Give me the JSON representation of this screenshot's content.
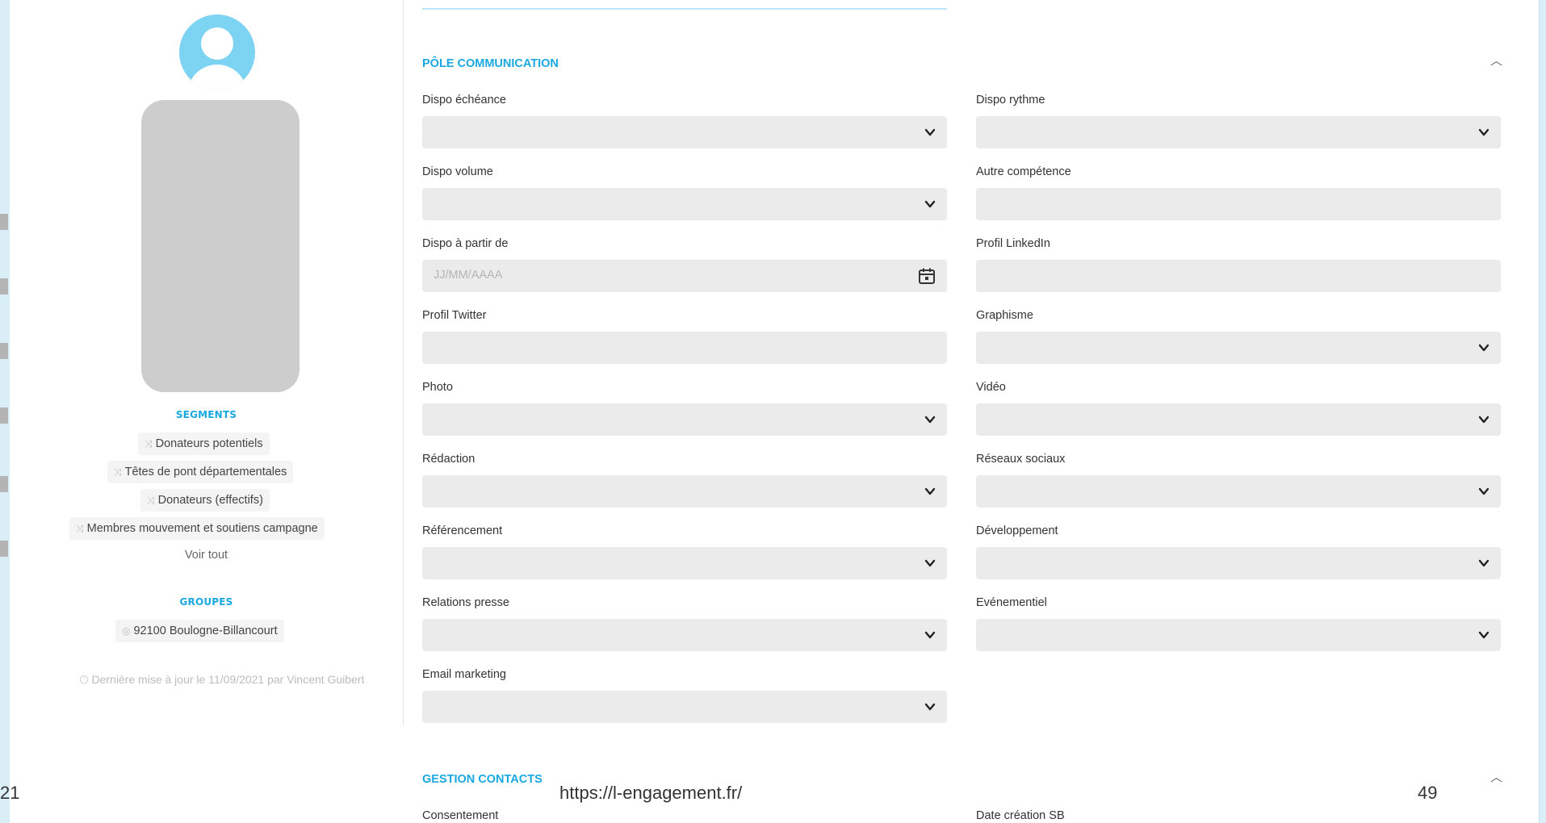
{
  "profile": {
    "segments_title": "SEGMENTS",
    "segments": [
      "Donateurs potentiels",
      "Têtes de pont départementales",
      "Donateurs (effectifs)",
      "Membres mouvement et soutiens campagne"
    ],
    "see_all": "Voir tout",
    "groups_title": "GROUPES",
    "groups": [
      "92100 Boulogne-Billancourt"
    ],
    "update_note": "Dernière mise à jour le 11/09/2021 par Vincent Guibert"
  },
  "pole_communication": {
    "title": "PÔLE COMMUNICATION",
    "fields_left": [
      {
        "label": "Dispo échéance",
        "type": "select",
        "value": ""
      },
      {
        "label": "Dispo volume",
        "type": "select",
        "value": ""
      },
      {
        "label": "Dispo à partir de",
        "type": "date",
        "placeholder": "JJ/MM/AAAA"
      },
      {
        "label": "Profil Twitter",
        "type": "text",
        "value": ""
      },
      {
        "label": "Photo",
        "type": "select",
        "value": ""
      },
      {
        "label": "Rédaction",
        "type": "select",
        "value": ""
      },
      {
        "label": "Référencement",
        "type": "select",
        "value": ""
      },
      {
        "label": "Relations presse",
        "type": "select",
        "value": ""
      },
      {
        "label": "Email marketing",
        "type": "select",
        "value": ""
      }
    ],
    "fields_right": [
      {
        "label": "Dispo rythme",
        "type": "select",
        "value": ""
      },
      {
        "label": "Autre compétence",
        "type": "text",
        "value": ""
      },
      {
        "label": "Profil LinkedIn",
        "type": "text",
        "value": ""
      },
      {
        "label": "Graphisme",
        "type": "select",
        "value": ""
      },
      {
        "label": "Vidéo",
        "type": "select",
        "value": ""
      },
      {
        "label": "Réseaux sociaux",
        "type": "select",
        "value": ""
      },
      {
        "label": "Développement",
        "type": "select",
        "value": ""
      },
      {
        "label": "Evénementiel",
        "type": "select",
        "value": ""
      }
    ]
  },
  "gestion_contacts": {
    "title": "GESTION CONTACTS",
    "field_left_label": "Consentement",
    "field_right_label": "Date création SB"
  },
  "slide_footer": {
    "url": "https://l-engagement.fr/",
    "page_number": "49",
    "left_fragment": "21"
  },
  "colors": {
    "accent": "#1aa8e0",
    "field_bg": "#ebebeb",
    "avatar": "#7dd3f2",
    "photo_placeholder": "#cdcdcd",
    "backdrop": "#daeef8"
  },
  "icons": {
    "segment": "shuffle-icon",
    "group": "group-icon",
    "update": "clock-icon",
    "select": "chevron-down-icon",
    "date": "calendar-icon",
    "collapse": "chevron-up-icon"
  }
}
